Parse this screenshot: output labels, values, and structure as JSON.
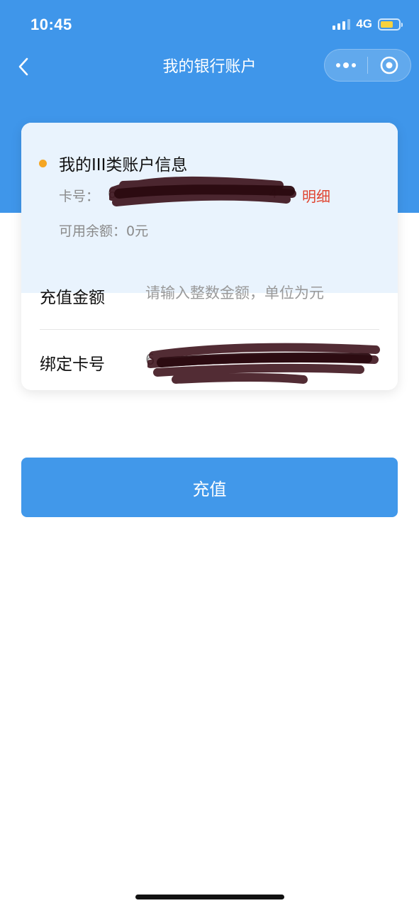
{
  "status_bar": {
    "time": "10:45",
    "network": "4G"
  },
  "nav": {
    "title": "我的银行账户",
    "back_icon": "chevron-left-icon",
    "more_icon": "more-dots-icon",
    "close_icon": "target-circle-icon"
  },
  "account": {
    "title": "我的III类账户信息",
    "card_no_label": "卡号：",
    "card_no_visible": "6",
    "card_no_tail_visible": "4",
    "detail_link": "明细",
    "balance": "可用余额：0元"
  },
  "form": {
    "amount_label": "充值金额",
    "amount_value": "",
    "amount_placeholder": "请输入整数金额，单位为元",
    "bind_label": "绑定卡号",
    "bind_value_visible": "6"
  },
  "actions": {
    "recharge_label": "充值"
  },
  "colors": {
    "primary": "#3f96ea",
    "button": "#4198ea",
    "link": "#e0442f",
    "bullet": "#f5a623",
    "info_bg": "#e9f3fd"
  }
}
